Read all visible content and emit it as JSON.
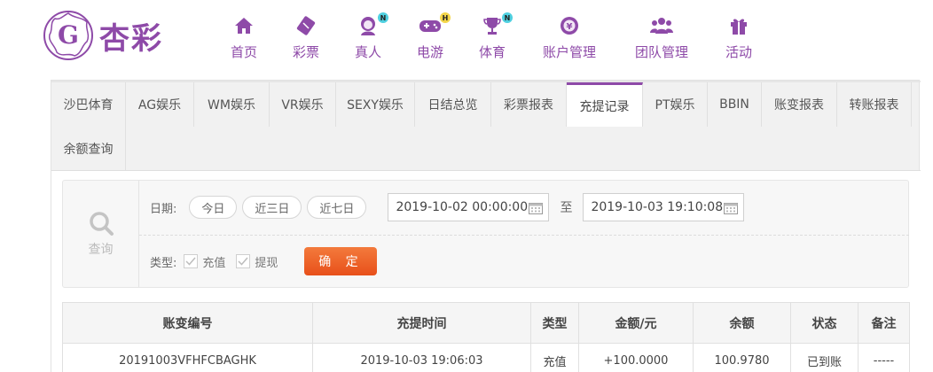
{
  "brand": {
    "name": "杏彩",
    "accent": "#8e4aa8"
  },
  "nav": [
    {
      "label": "首页",
      "icon": "home-icon",
      "badge": ""
    },
    {
      "label": "彩票",
      "icon": "ticket-icon",
      "badge": ""
    },
    {
      "label": "真人",
      "icon": "dealer-icon",
      "badge": "N"
    },
    {
      "label": "电游",
      "icon": "gamepad-icon",
      "badge": "H"
    },
    {
      "label": "体育",
      "icon": "trophy-icon",
      "badge": "N"
    },
    {
      "label": "账户管理",
      "icon": "account-icon",
      "badge": ""
    },
    {
      "label": "团队管理",
      "icon": "team-icon",
      "badge": ""
    },
    {
      "label": "活动",
      "icon": "gift-icon",
      "badge": ""
    }
  ],
  "tabs": [
    {
      "label": "沙巴体育"
    },
    {
      "label": "AG娱乐"
    },
    {
      "label": "WM娱乐"
    },
    {
      "label": "VR娱乐"
    },
    {
      "label": "SEXY娱乐"
    },
    {
      "label": "日结总览"
    },
    {
      "label": "彩票报表"
    },
    {
      "label": "充提记录",
      "active": true
    },
    {
      "label": "PT娱乐"
    },
    {
      "label": "BBIN"
    },
    {
      "label": "账变报表"
    },
    {
      "label": "转账报表"
    },
    {
      "label": "余额查询"
    }
  ],
  "filter": {
    "query_label": "查询",
    "date_label": "日期:",
    "quick_ranges": [
      "今日",
      "近三日",
      "近七日"
    ],
    "date_from": "2019-10-02 00:00:00",
    "date_to": "2019-10-03 19:10:08",
    "to_label": "至",
    "type_label": "类型:",
    "types": [
      {
        "label": "充值",
        "checked": true
      },
      {
        "label": "提现",
        "checked": true
      }
    ],
    "confirm_label": "确 定"
  },
  "table": {
    "headers": [
      "账变编号",
      "充提时间",
      "类型",
      "金额/元",
      "余额",
      "状态",
      "备注"
    ],
    "rows": [
      {
        "id": "20191003VFHFCBAGHK",
        "time": "2019-10-03 19:06:03",
        "type": "充值",
        "amount": "+100.0000",
        "balance": "100.9780",
        "status": "已到账",
        "note": "-----"
      }
    ]
  },
  "colors": {
    "amount": "#d0021b",
    "status": "#3b9b1b",
    "confirm": "#ee5b1c"
  }
}
